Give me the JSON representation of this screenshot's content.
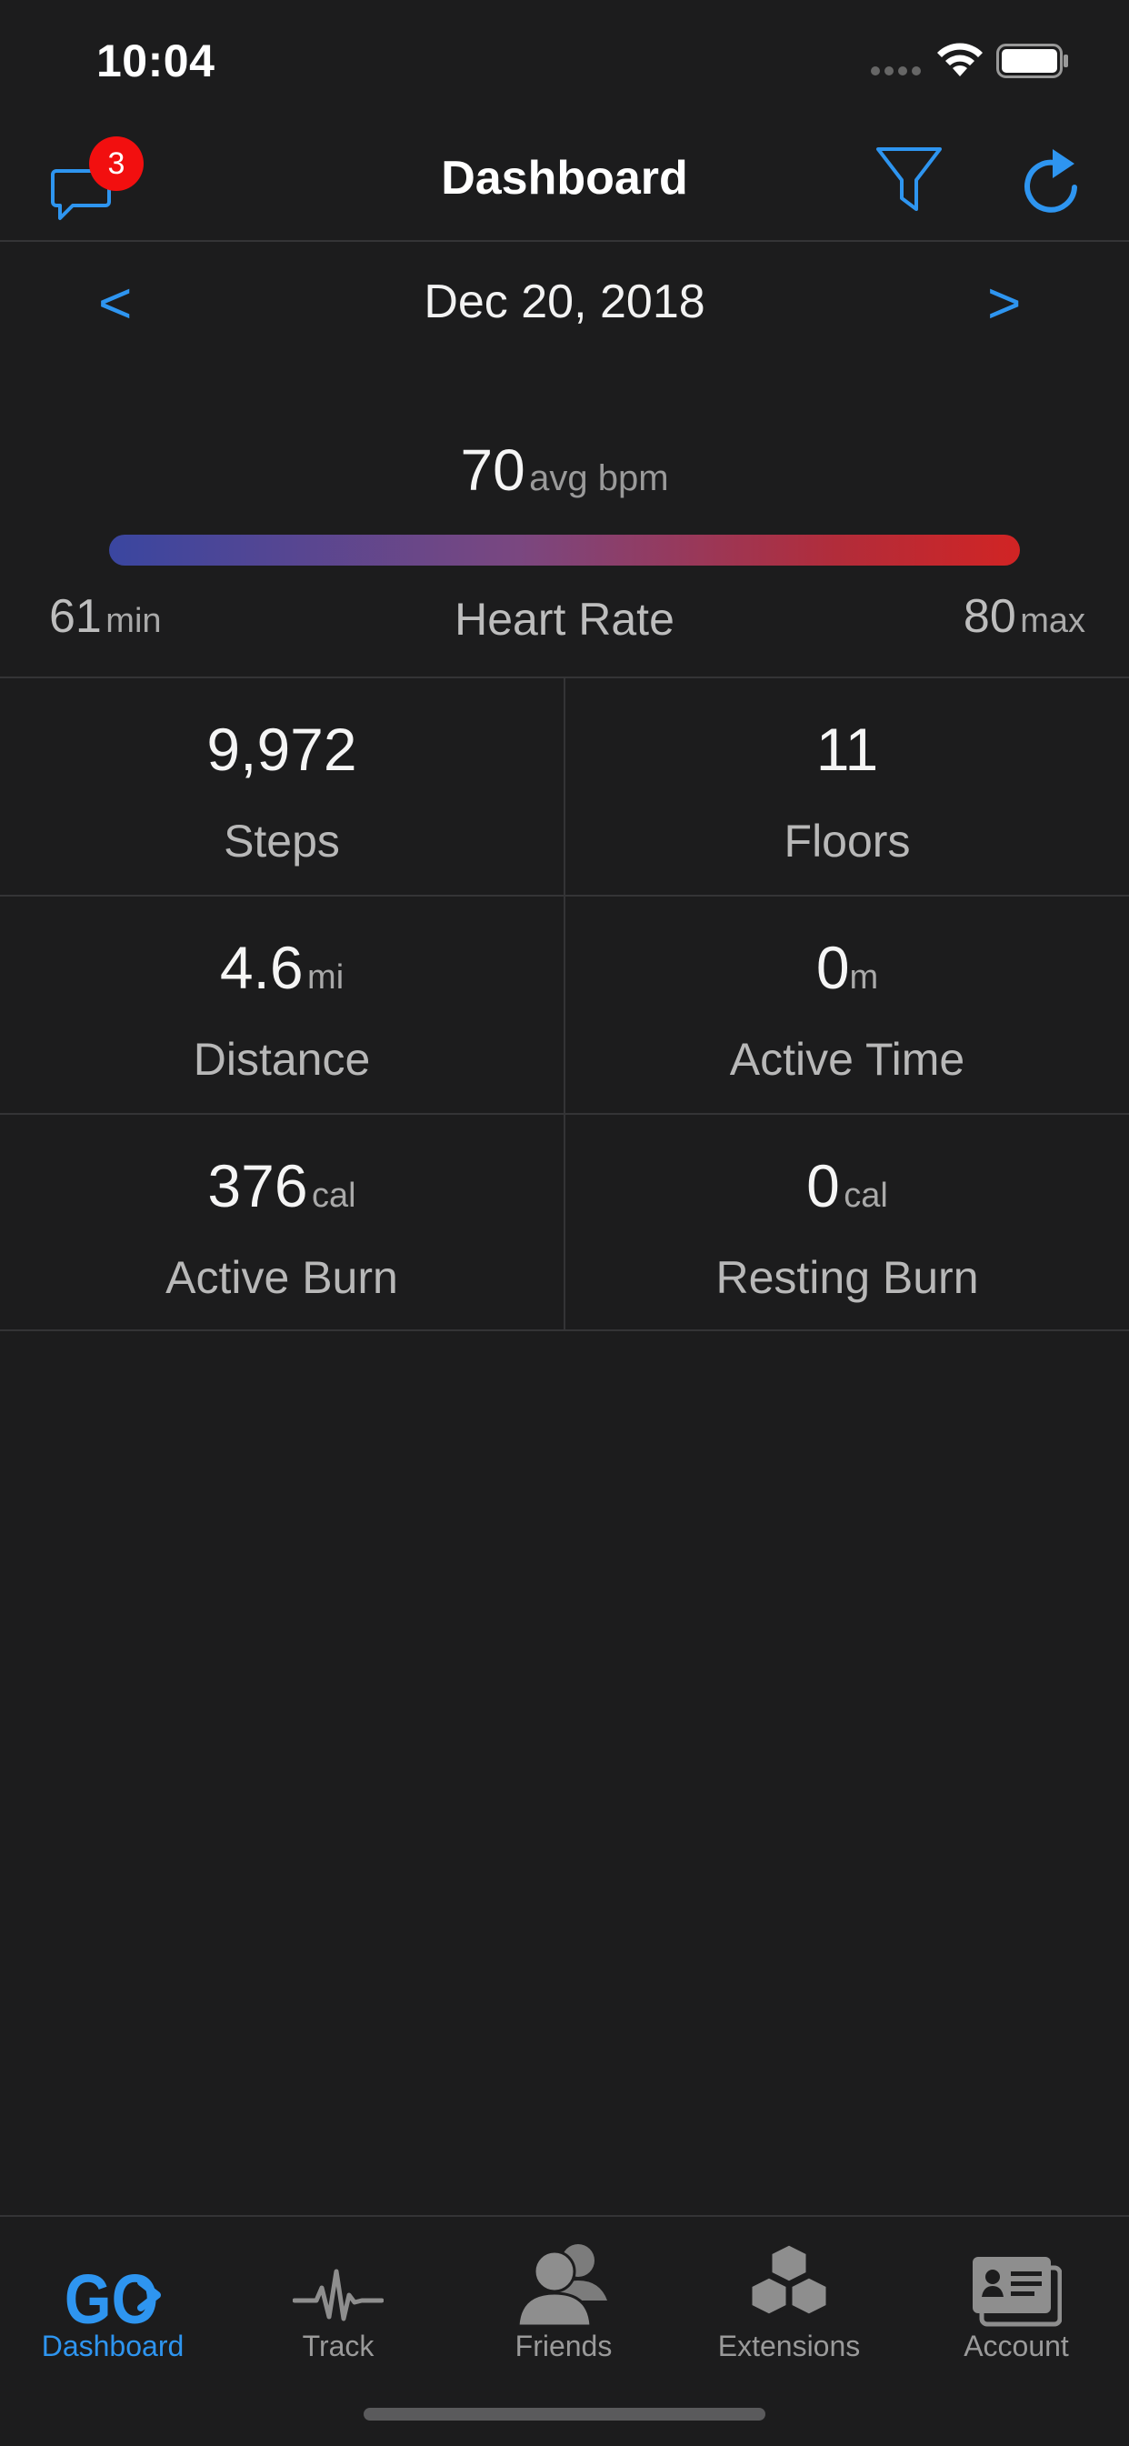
{
  "status_bar": {
    "time": "10:04"
  },
  "nav": {
    "title": "Dashboard",
    "messages_badge": "3"
  },
  "date": {
    "prev": "<",
    "label": "Dec 20, 2018",
    "next": ">"
  },
  "heart_rate": {
    "avg": "70",
    "avg_unit": "avg bpm",
    "min": "61",
    "min_unit": "min",
    "max": "80",
    "max_unit": "max",
    "label": "Heart Rate"
  },
  "stats": {
    "steps": {
      "value": "9,972",
      "label": "Steps"
    },
    "floors": {
      "value": "11",
      "label": "Floors"
    },
    "distance": {
      "value": "4.6",
      "unit": "mi",
      "label": "Distance"
    },
    "active_time": {
      "value": "0",
      "unit": "m",
      "label": "Active Time"
    },
    "active_burn": {
      "value": "376",
      "unit": "cal",
      "label": "Active Burn"
    },
    "resting_burn": {
      "value": "0",
      "unit": "cal",
      "label": "Resting Burn"
    }
  },
  "tabs": [
    {
      "label": "Dashboard",
      "icon": "go-logo-icon",
      "active": true
    },
    {
      "label": "Track",
      "icon": "heartbeat-icon",
      "active": false
    },
    {
      "label": "Friends",
      "icon": "friends-icon",
      "active": false
    },
    {
      "label": "Extensions",
      "icon": "cubes-icon",
      "active": false
    },
    {
      "label": "Account",
      "icon": "id-card-icon",
      "active": false
    }
  ],
  "colors": {
    "accent": "#2e95f0",
    "background": "#1c1c1d",
    "badge": "#f20f0f",
    "inactive": "#9a9a9a"
  }
}
